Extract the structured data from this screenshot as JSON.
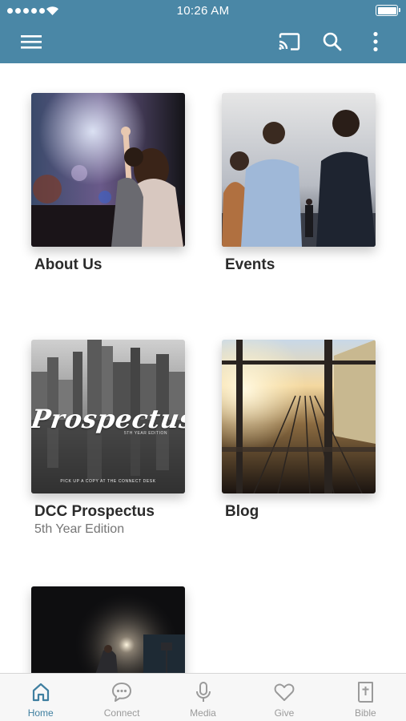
{
  "status_bar": {
    "time": "10:26 AM"
  },
  "colors": {
    "header": "#4a87a6",
    "tab_active": "#3f7fa0",
    "tab_inactive": "#9a9a9a",
    "title_text": "#2b2b2b",
    "subtitle_text": "#757575"
  },
  "header": {
    "icons": [
      "menu-icon",
      "cast-icon",
      "search-icon",
      "more-vertical-icon"
    ]
  },
  "tiles": [
    {
      "title": "About Us",
      "subtitle": ""
    },
    {
      "title": "Events",
      "subtitle": ""
    },
    {
      "title": "DCC Prospectus",
      "subtitle": "5th Year Edition",
      "image_text": {
        "wordmark": "Prospectus",
        "edition": "5TH YEAR EDITION",
        "tagline": "PICK UP A COPY AT THE CONNECT DESK"
      }
    },
    {
      "title": "Blog",
      "subtitle": ""
    },
    {
      "title": "",
      "subtitle": ""
    }
  ],
  "tabbar": {
    "active": "Home",
    "tabs": [
      {
        "label": "Home",
        "icon": "home-icon"
      },
      {
        "label": "Connect",
        "icon": "chat-bubble-icon"
      },
      {
        "label": "Media",
        "icon": "microphone-icon"
      },
      {
        "label": "Give",
        "icon": "heart-icon"
      },
      {
        "label": "Bible",
        "icon": "bible-icon"
      }
    ]
  }
}
